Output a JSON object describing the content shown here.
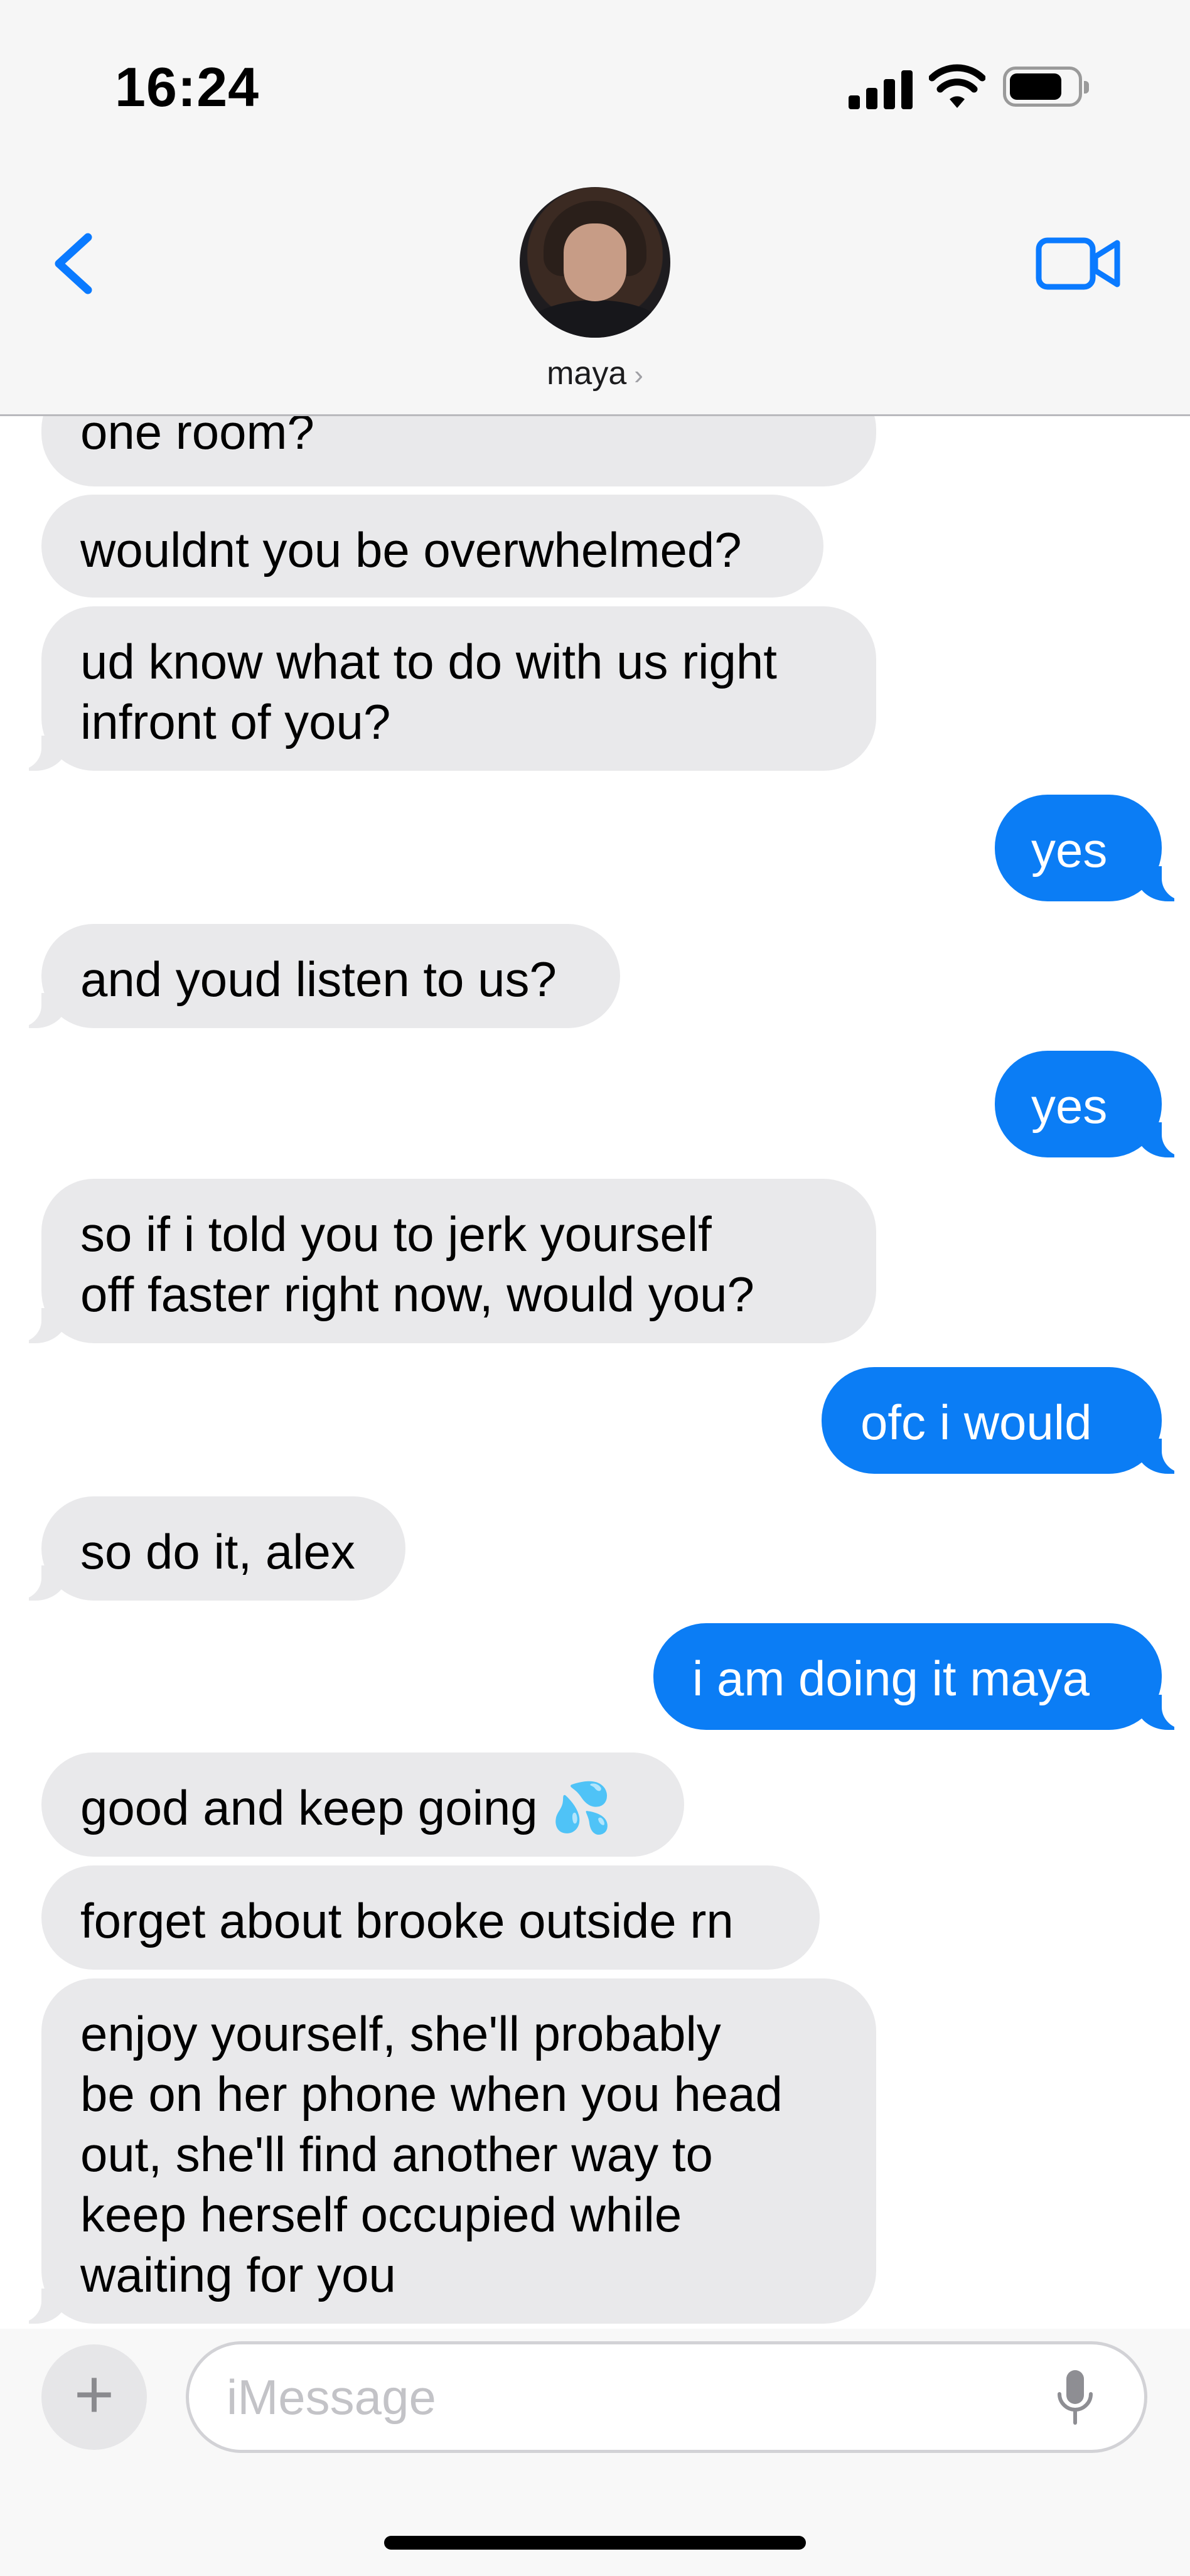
{
  "status_bar": {
    "time": "16:24"
  },
  "header": {
    "contact_name": "maya",
    "contact_chevron": "›"
  },
  "messages": [
    {
      "text": "one room?"
    },
    {
      "text": "wouldnt you be overwhelmed?"
    },
    {
      "text": "ud know what to do with us right\ninfront of you?"
    },
    {
      "text": "yes"
    },
    {
      "text": "and youd listen to us?"
    },
    {
      "text": "yes"
    },
    {
      "text": "so if i told you to jerk yourself\noff faster right now, would you?"
    },
    {
      "text": "ofc i would"
    },
    {
      "text": "so do it, alex"
    },
    {
      "text": "i am doing it maya"
    },
    {
      "text": "good and keep going 💦"
    },
    {
      "text": "forget about brooke outside rn"
    },
    {
      "text": "enjoy yourself, she'll probably\nbe on her phone when you head\nout, she'll find another way to\nkeep herself occupied while\nwaiting for you"
    }
  ],
  "composer": {
    "placeholder": "iMessage",
    "plus_label": "+"
  },
  "colors": {
    "outgoing": "#0b7df5",
    "incoming": "#e9e9eb",
    "accent": "#0a7aff"
  },
  "icons": [
    "back-chevron-icon",
    "video-camera-icon",
    "microphone-icon",
    "cellular-signal-icon",
    "wifi-icon",
    "battery-icon"
  ]
}
